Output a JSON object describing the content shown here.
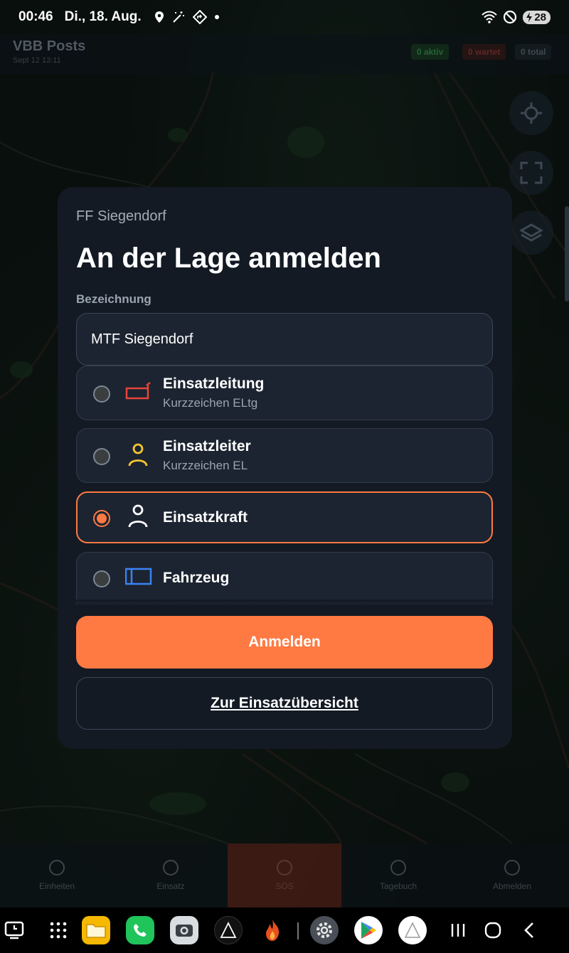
{
  "status_bar": {
    "time": "00:46",
    "date": "Di., 18. Aug.",
    "battery": "28"
  },
  "app_header": {
    "title": "VBB Posts",
    "subtitle": "Sept 12 13:11",
    "pills": [
      "0 aktiv",
      "0 wartet",
      "0 total"
    ]
  },
  "modal": {
    "organization": "FF Siegendorf",
    "title": "An der Lage anmelden",
    "field_label": "Bezeichnung",
    "field_value": "MTF Siegendorf",
    "options": [
      {
        "label": "Einsatzleitung",
        "sub": "Kurzzeichen ELtg",
        "icon": "command-vehicle-icon",
        "color": "#e5453a",
        "selected": false
      },
      {
        "label": "Einsatzleiter",
        "sub": "Kurzzeichen EL",
        "icon": "person-icon",
        "color": "#f4c430",
        "selected": false
      },
      {
        "label": "Einsatzkraft",
        "sub": "",
        "icon": "person-icon",
        "color": "#ffffff",
        "selected": true
      },
      {
        "label": "Fahrzeug",
        "sub": "",
        "icon": "vehicle-icon",
        "color": "#3b82f6",
        "selected": false
      }
    ],
    "primary_button": "Anmelden",
    "secondary_button": "Zur Einsatzübersicht"
  },
  "bottom_nav": {
    "items": [
      "Einheiten",
      "Einsatz",
      "SOS",
      "Tagebuch",
      "Abmelden"
    ],
    "active_index": 2
  },
  "taskbar": {
    "apps": [
      "recent-apps-icon",
      "app-drawer-icon",
      "files-icon",
      "phone-icon",
      "camera-icon",
      "delta-app-icon",
      "fire-app-icon",
      "settings-icon",
      "play-store-icon",
      "triangle-app-icon"
    ],
    "nav": [
      "recents-button",
      "home-button",
      "back-button"
    ]
  },
  "colors": {
    "accent": "#ff7a42",
    "modal_bg": "#131a24",
    "field_bg": "#1c2431"
  }
}
